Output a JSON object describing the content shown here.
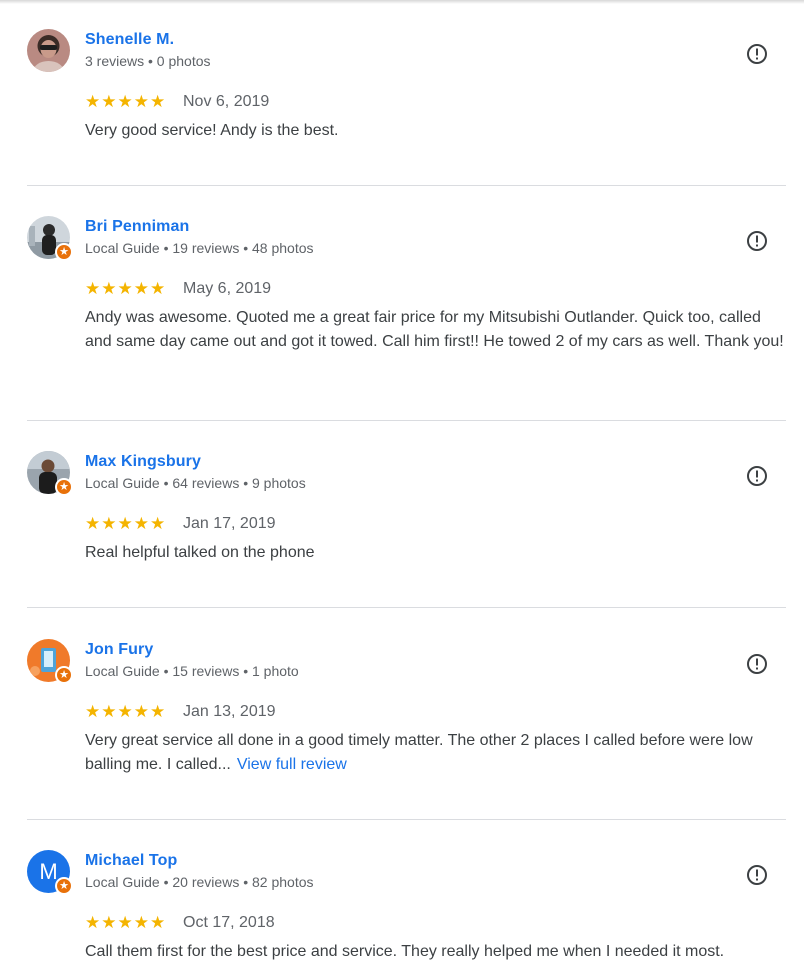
{
  "reviews": [
    {
      "name": "Shenelle M.",
      "meta": "3 reviews • 0 photos",
      "stars": "★★★★★",
      "rating": 5,
      "date": "Nov 6, 2019",
      "text": "Very good service! Andy is the best.",
      "avatar_badge": false
    },
    {
      "name": "Bri Penniman",
      "meta": "Local Guide • 19 reviews • 48 photos",
      "stars": "★★★★★",
      "rating": 5,
      "date": "May 6, 2019",
      "text": "Andy was awesome. Quoted me a great fair price for my Mitsubishi Outlander. Quick too, called and same day came out and got it towed. Call him first!! He towed 2 of my cars as well. Thank you!",
      "avatar_badge": true
    },
    {
      "name": "Max Kingsbury",
      "meta": "Local Guide • 64 reviews • 9 photos",
      "stars": "★★★★★",
      "rating": 5,
      "date": "Jan 17, 2019",
      "text": "Real helpful talked on the phone",
      "avatar_badge": true
    },
    {
      "name": "Jon Fury",
      "meta": "Local Guide • 15 reviews • 1 photo",
      "stars": "★★★★★",
      "rating": 5,
      "date": "Jan 13, 2019",
      "text": "Very great service all done in a good timely matter. The other 2 places I called before were low balling me. I called...",
      "more_label": "View full review",
      "avatar_badge": true
    },
    {
      "name": "Michael Top",
      "meta": "Local Guide • 20 reviews • 82 photos",
      "stars": "★★★★★",
      "rating": 5,
      "date": "Oct 17, 2018",
      "text": "Call them first for the best price and service. They really helped me when I needed it most.",
      "avatar_letter": "M",
      "avatar_badge": true
    }
  ],
  "icons": {
    "flag": "report-flag-icon",
    "badge": "local-guide-star-icon"
  },
  "colors": {
    "name": "#1a73e8",
    "stars": "#f4b400",
    "badge": "#e8710a",
    "meta": "#5f6368"
  }
}
